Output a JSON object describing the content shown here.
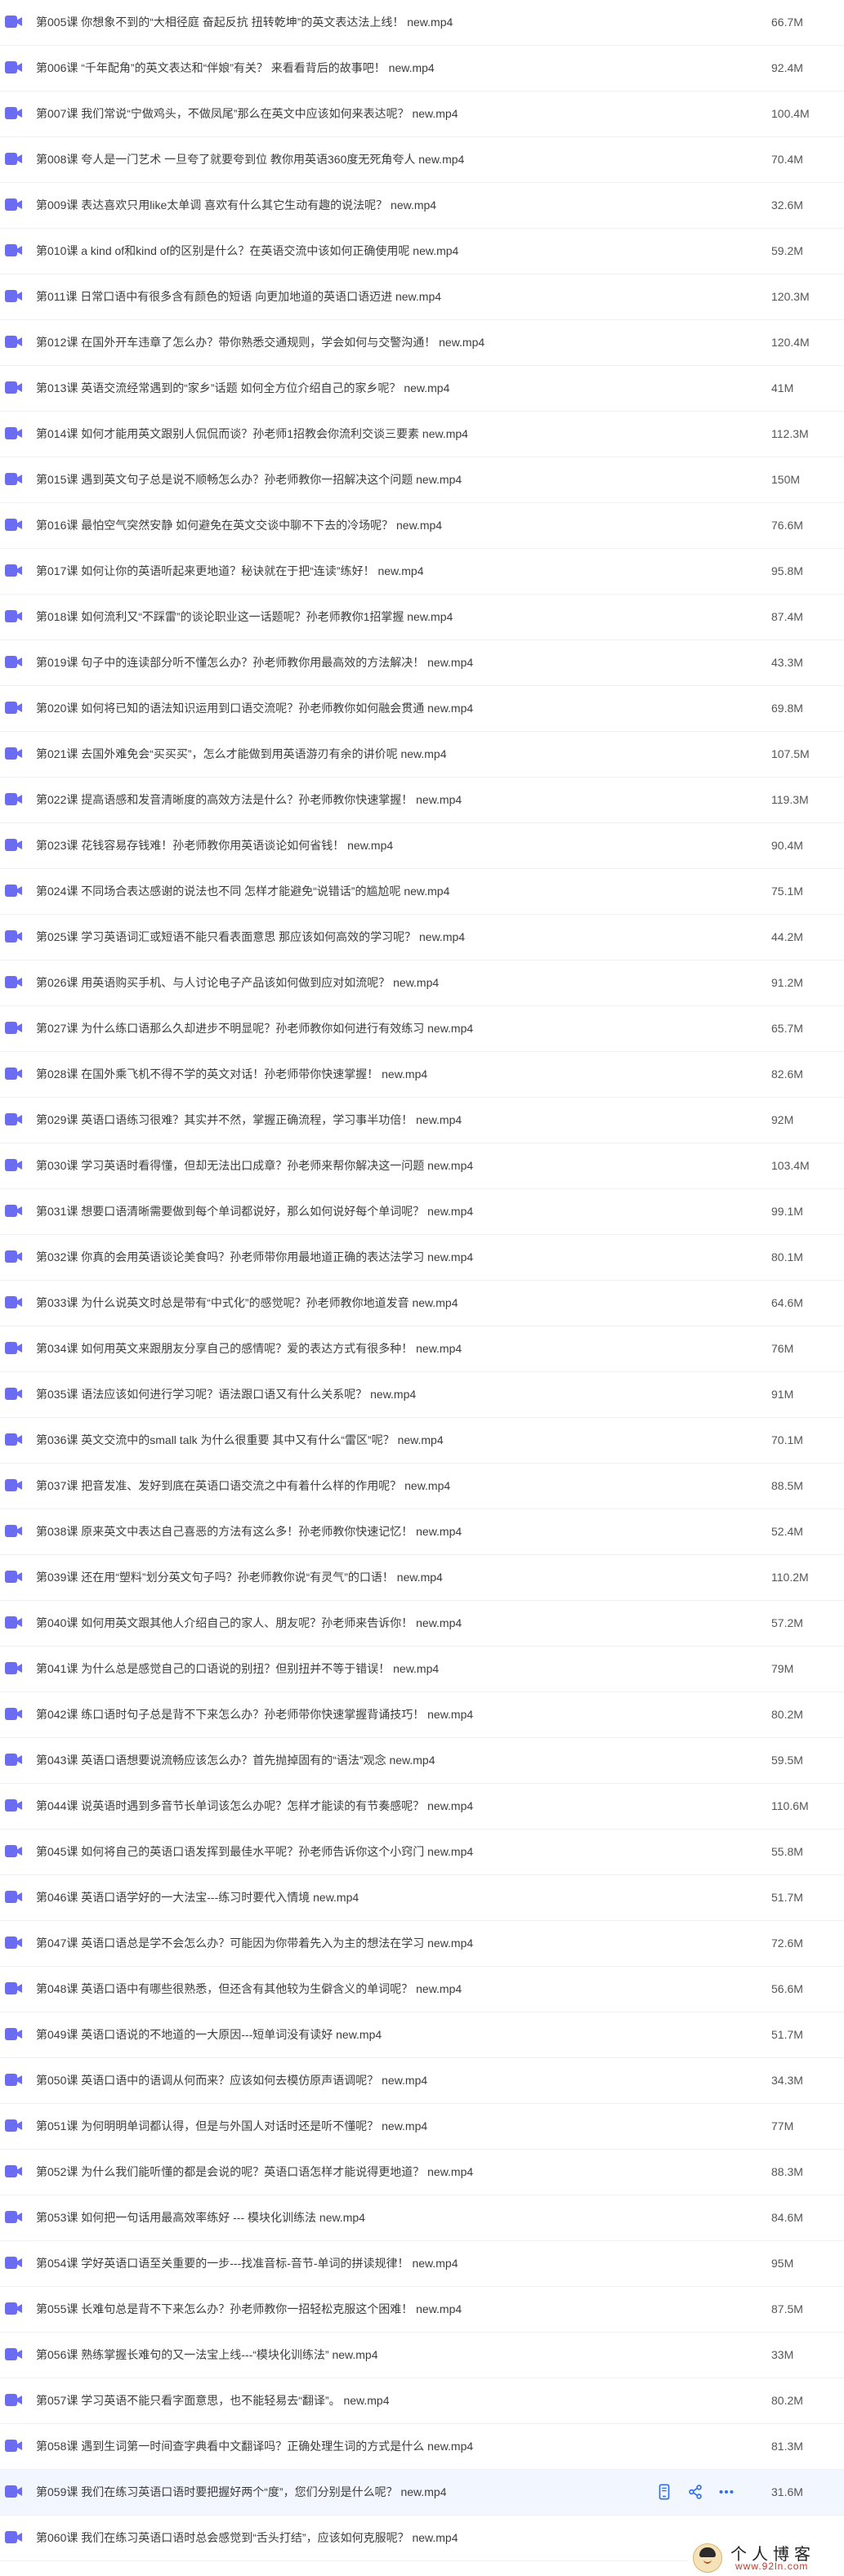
{
  "colors": {
    "file_icon": "#6c6cf3",
    "selected_row": "#f2f6ff",
    "action_icon": "#2f6fea"
  },
  "files": [
    {
      "name": "第005课 你想象不到的“大相径庭 奋起反抗 扭转乾坤”的英文表达法上线！ new.mp4",
      "size": "66.7M"
    },
    {
      "name": "第006课 “千年配角”的英文表达和“伴娘”有关？ 来看看背后的故事吧！ new.mp4",
      "size": "92.4M"
    },
    {
      "name": "第007课 我们常说“宁做鸡头，不做凤尾”那么在英文中应该如何来表达呢？ new.mp4",
      "size": "100.4M"
    },
    {
      "name": "第008课 夸人是一门艺术 一旦夸了就要夸到位 教你用英语360度无死角夸人 new.mp4",
      "size": "70.4M"
    },
    {
      "name": "第009课 表达喜欢只用like太单调 喜欢有什么其它生动有趣的说法呢？ new.mp4",
      "size": "32.6M"
    },
    {
      "name": "第010课 a kind of和kind of的区别是什么？在英语交流中该如何正确使用呢 new.mp4",
      "size": "59.2M"
    },
    {
      "name": "第011课 日常口语中有很多含有颜色的短语 向更加地道的英语口语迈进 new.mp4",
      "size": "120.3M"
    },
    {
      "name": "第012课 在国外开车违章了怎么办？带你熟悉交通规则，学会如何与交警沟通！ new.mp4",
      "size": "120.4M"
    },
    {
      "name": "第013课 英语交流经常遇到的“家乡”话题 如何全方位介绍自己的家乡呢？ new.mp4",
      "size": "41M"
    },
    {
      "name": "第014课 如何才能用英文跟别人侃侃而谈？孙老师1招教会你流利交谈三要素 new.mp4",
      "size": "112.3M"
    },
    {
      "name": "第015课 遇到英文句子总是说不顺畅怎么办？孙老师教你一招解决这个问题 new.mp4",
      "size": "150M"
    },
    {
      "name": "第016课 最怕空气突然安静 如何避免在英文交谈中聊不下去的冷场呢？ new.mp4",
      "size": "76.6M"
    },
    {
      "name": "第017课 如何让你的英语听起来更地道？秘诀就在于把“连读”练好！ new.mp4",
      "size": "95.8M"
    },
    {
      "name": "第018课 如何流利又“不踩雷”的谈论职业这一话题呢？孙老师教你1招掌握 new.mp4",
      "size": "87.4M"
    },
    {
      "name": "第019课 句子中的连读部分听不懂怎么办？孙老师教你用最高效的方法解决！ new.mp4",
      "size": "43.3M"
    },
    {
      "name": "第020课 如何将已知的语法知识运用到口语交流呢？孙老师教你如何融会贯通 new.mp4",
      "size": "69.8M"
    },
    {
      "name": "第021课 去国外难免会“买买买”，怎么才能做到用英语游刃有余的讲价呢 new.mp4",
      "size": "107.5M"
    },
    {
      "name": "第022课 提高语感和发音清晰度的高效方法是什么？孙老师教你快速掌握！ new.mp4",
      "size": "119.3M"
    },
    {
      "name": "第023课 花钱容易存钱难！孙老师教你用英语谈论如何省钱！ new.mp4",
      "size": "90.4M"
    },
    {
      "name": "第024课 不同场合表达感谢的说法也不同 怎样才能避免“说错话”的尴尬呢 new.mp4",
      "size": "75.1M"
    },
    {
      "name": "第025课 学习英语词汇或短语不能只看表面意思 那应该如何高效的学习呢？ new.mp4",
      "size": "44.2M"
    },
    {
      "name": "第026课 用英语购买手机、与人讨论电子产品该如何做到应对如流呢？ new.mp4",
      "size": "91.2M"
    },
    {
      "name": "第027课 为什么练口语那么久却进步不明显呢？孙老师教你如何进行有效练习 new.mp4",
      "size": "65.7M"
    },
    {
      "name": "第028课 在国外乘飞机不得不学的英文对话！孙老师带你快速掌握！ new.mp4",
      "size": "82.6M"
    },
    {
      "name": "第029课 英语口语练习很难？其实并不然，掌握正确流程，学习事半功倍！ new.mp4",
      "size": "92M"
    },
    {
      "name": "第030课 学习英语时看得懂，但却无法出口成章？孙老师来帮你解决这一问题 new.mp4",
      "size": "103.4M"
    },
    {
      "name": "第031课 想要口语清晰需要做到每个单词都说好，那么如何说好每个单词呢？ new.mp4",
      "size": "99.1M"
    },
    {
      "name": "第032课 你真的会用英语谈论美食吗？孙老师带你用最地道正确的表达法学习 new.mp4",
      "size": "80.1M"
    },
    {
      "name": "第033课 为什么说英文时总是带有“中式化”的感觉呢？孙老师教你地道发音 new.mp4",
      "size": "64.6M"
    },
    {
      "name": "第034课 如何用英文来跟朋友分享自己的感情呢？爱的表达方式有很多种！ new.mp4",
      "size": "76M"
    },
    {
      "name": "第035课 语法应该如何进行学习呢？语法跟口语又有什么关系呢？ new.mp4",
      "size": "91M"
    },
    {
      "name": "第036课 英文交流中的small talk 为什么很重要 其中又有什么“雷区”呢？ new.mp4",
      "size": "70.1M"
    },
    {
      "name": "第037课 把音发准、发好到底在英语口语交流之中有着什么样的作用呢？ new.mp4",
      "size": "88.5M"
    },
    {
      "name": "第038课 原来英文中表达自己喜恶的方法有这么多！孙老师教你快速记忆！ new.mp4",
      "size": "52.4M"
    },
    {
      "name": "第039课 还在用“塑料”划分英文句子吗？孙老师教你说“有灵气”的口语！ new.mp4",
      "size": "110.2M"
    },
    {
      "name": "第040课 如何用英文跟其他人介绍自己的家人、朋友呢？孙老师来告诉你！ new.mp4",
      "size": "57.2M"
    },
    {
      "name": "第041课 为什么总是感觉自己的口语说的别扭？但别扭并不等于错误！ new.mp4",
      "size": "79M"
    },
    {
      "name": "第042课 练口语时句子总是背不下来怎么办？孙老师带你快速掌握背诵技巧！ new.mp4",
      "size": "80.2M"
    },
    {
      "name": "第043课 英语口语想要说流畅应该怎么办？首先抛掉固有的“语法”观念 new.mp4",
      "size": "59.5M"
    },
    {
      "name": "第044课 说英语时遇到多音节长单词该怎么办呢？怎样才能读的有节奏感呢？ new.mp4",
      "size": "110.6M"
    },
    {
      "name": "第045课 如何将自己的英语口语发挥到最佳水平呢？孙老师告诉你这个小窍门 new.mp4",
      "size": "55.8M"
    },
    {
      "name": "第046课 英语口语学好的一大法宝---练习时要代入情境 new.mp4",
      "size": "51.7M"
    },
    {
      "name": "第047课 英语口语总是学不会怎么办？可能因为你带着先入为主的想法在学习 new.mp4",
      "size": "72.6M"
    },
    {
      "name": "第048课 英语口语中有哪些很熟悉，但还含有其他较为生僻含义的单词呢？ new.mp4",
      "size": "56.6M"
    },
    {
      "name": "第049课 英语口语说的不地道的一大原因---短单词没有读好 new.mp4",
      "size": "51.7M"
    },
    {
      "name": "第050课 英语口语中的语调从何而来？应该如何去模仿原声语调呢？ new.mp4",
      "size": "34.3M"
    },
    {
      "name": "第051课 为何明明单词都认得，但是与外国人对话时还是听不懂呢？ new.mp4",
      "size": "77M"
    },
    {
      "name": "第052课 为什么我们能听懂的都是会说的呢？英语口语怎样才能说得更地道？ new.mp4",
      "size": "88.3M"
    },
    {
      "name": "第053课 如何把一句话用最高效率练好 --- 模块化训练法 new.mp4",
      "size": "84.6M"
    },
    {
      "name": "第054课 学好英语口语至关重要的一步---找准音标-音节-单词的拼读规律！ new.mp4",
      "size": "95M"
    },
    {
      "name": "第055课 长难句总是背不下来怎么办？孙老师教你一招轻松克服这个困难！ new.mp4",
      "size": "87.5M"
    },
    {
      "name": "第056课 熟练掌握长难句的又一法宝上线---“模块化训练法” new.mp4",
      "size": "33M"
    },
    {
      "name": "第057课 学习英语不能只看字面意思，也不能轻易去“翻译”。 new.mp4",
      "size": "80.2M"
    },
    {
      "name": "第058课 遇到生词第一时间查字典看中文翻译吗？正确处理生词的方式是什么 new.mp4",
      "size": "81.3M"
    },
    {
      "name": "第059课 我们在练习英语口语时要把握好两个“度”，您们分别是什么呢？ new.mp4",
      "size": "31.6M"
    },
    {
      "name": "第060课 我们在练习英语口语时总会感觉到“舌头打结”，应该如何克服呢？ new.mp4",
      "size": ""
    }
  ],
  "selected_index": 54,
  "row_actions": [
    {
      "icon": "mobile-icon"
    },
    {
      "icon": "share-icon"
    },
    {
      "icon": "more-icon"
    }
  ],
  "watermark": {
    "title": "个人博客",
    "site": "www.92ln.com"
  }
}
